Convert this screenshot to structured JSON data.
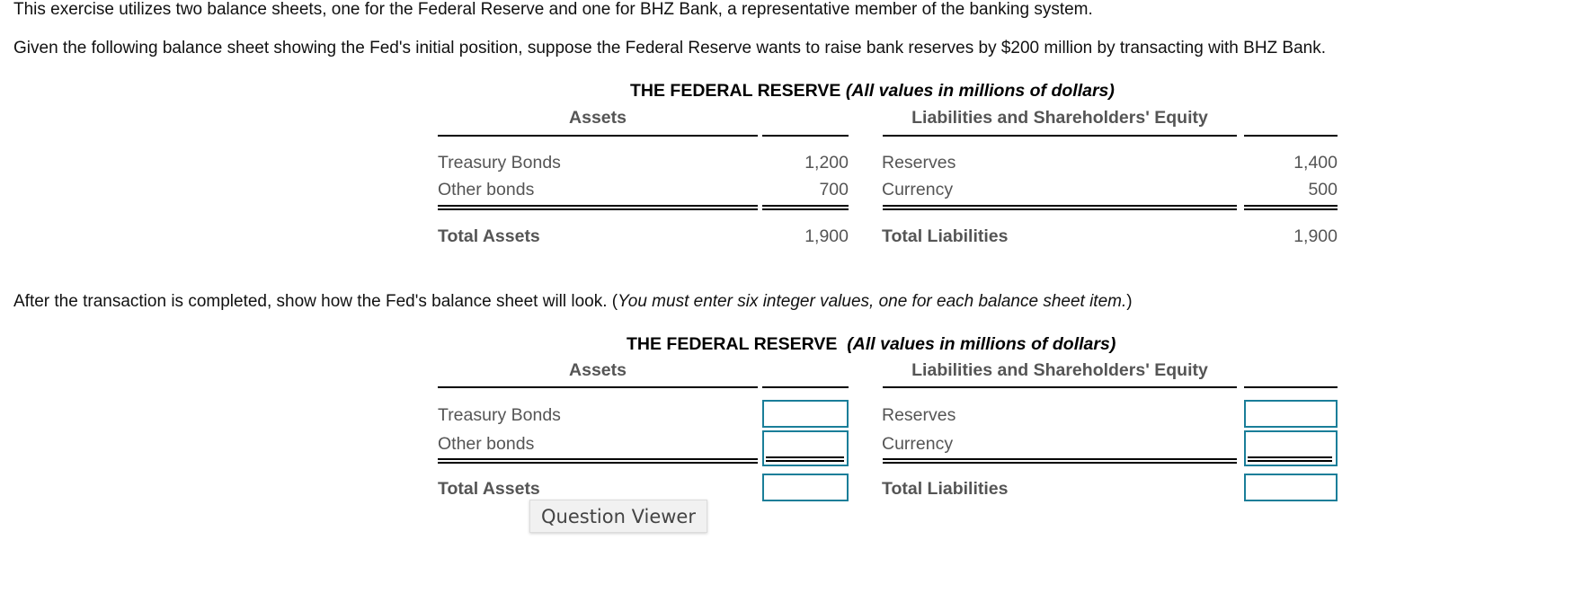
{
  "intro": {
    "paragraph1": "This exercise utilizes two balance sheets, one for the Federal Reserve and one for BHZ Bank, a representative member of the banking system.",
    "paragraph2": "Given the following balance sheet showing the Fed's initial position, suppose the Federal Reserve wants to raise bank reserves by $200 million by transacting with BHZ Bank."
  },
  "initial_sheet": {
    "title": "THE FEDERAL RESERVE",
    "subtitle": "(All values in millions of dollars)",
    "assets_header": "Assets",
    "liabilities_header": "Liabilities and Shareholders' Equity",
    "assets": [
      {
        "label": "Treasury Bonds",
        "value": "1,200"
      },
      {
        "label": "Other bonds",
        "value": "700"
      }
    ],
    "liabilities": [
      {
        "label": "Reserves",
        "value": "1,400"
      },
      {
        "label": "Currency",
        "value": "500"
      }
    ],
    "total_assets": {
      "label": "Total Assets",
      "value": "1,900"
    },
    "total_liabilities": {
      "label": "Total Liabilities",
      "value": "1,900"
    }
  },
  "instruction": {
    "text": "After the transaction is completed, show how the Fed's balance sheet will look. (",
    "italic": "You must enter six integer values, one for each balance sheet item.",
    "close": ")"
  },
  "answer_sheet": {
    "title": "THE FEDERAL RESERVE",
    "subtitle": "(All values in millions of dollars)",
    "assets_header": "Assets",
    "liabilities_header": "Liabilities and Shareholders' Equity",
    "assets": [
      {
        "label": "Treasury Bonds",
        "value": ""
      },
      {
        "label": "Other bonds",
        "value": ""
      }
    ],
    "liabilities": [
      {
        "label": "Reserves",
        "value": ""
      },
      {
        "label": "Currency",
        "value": ""
      }
    ],
    "total_assets": {
      "label": "Total Assets",
      "value": ""
    },
    "total_liabilities": {
      "label": "Total Liabilities",
      "value": ""
    }
  },
  "tooltip": {
    "label": "Question Viewer"
  }
}
